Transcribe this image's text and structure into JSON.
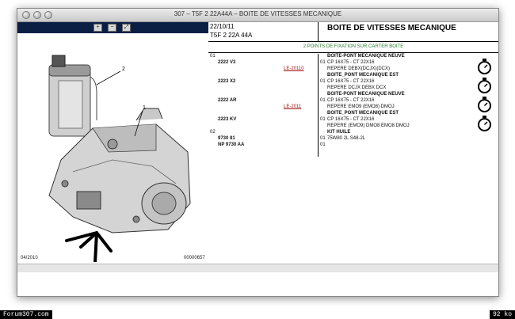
{
  "window": {
    "title": "307 – T5F 2 22A44A – BOITE DE VITESSES MECANIQUE"
  },
  "image_toolbar": {
    "zoom_in_icon": "magnifier-plus-icon",
    "zoom_out_icon": "magnifier-minus-icon",
    "fit_icon": "magnifier-fit-icon"
  },
  "figure": {
    "callout_1": "1",
    "callout_2": "2",
    "date": "04/2010",
    "ref": "00000657"
  },
  "header": {
    "date": "22/10/11",
    "code": "T5F 2 22A 44A",
    "description": "BOITE DE VITESSES MECANIQUE"
  },
  "fixing_note": "2 POINTS DE FIXATION SUR CARTER BOITE",
  "parts": [
    {
      "col1": "01",
      "col2": "",
      "qty": "",
      "text": "BOITE-PONT MECANIQUE NEUVE",
      "bold": true
    },
    {
      "col1": "",
      "col2": "2222 V3",
      "qty": "01",
      "text": "CP 16X75 - CT 22X16",
      "bold": false
    },
    {
      "col1": "",
      "col2": "LE-20110",
      "qty": "",
      "text": "REPERE DEBX(DCJX)(DCX)",
      "bold": false,
      "red": true
    },
    {
      "col1": "",
      "col2": "",
      "qty": "",
      "text": "BOITE_PONT MECANIQUE EST",
      "bold": true
    },
    {
      "col1": "",
      "col2": "2223 X2",
      "qty": "01",
      "text": "CP 16X75 - CT 22X16",
      "bold": false
    },
    {
      "col1": "",
      "col2": "",
      "qty": "",
      "text": "REPERE DCJX DEBX DCX",
      "bold": false
    },
    {
      "col1": "",
      "col2": "",
      "qty": "",
      "text": "BOITE-PONT MECANIQUE NEUVE",
      "bold": true
    },
    {
      "col1": "",
      "col2": "2222 AR",
      "qty": "01",
      "text": "CP 16X75 - CT 22X16",
      "bold": false
    },
    {
      "col1": "",
      "col2": "LE-2011",
      "qty": "",
      "text": "REPERE EMO9 (EMO8) DMOJ",
      "bold": false,
      "red": true
    },
    {
      "col1": "",
      "col2": "",
      "qty": "",
      "text": "BOITE_PONT MECANIQUE EST",
      "bold": true
    },
    {
      "col1": "",
      "col2": "2223 KV",
      "qty": "01",
      "text": "CP 16X75 - CT 22X16",
      "bold": false
    },
    {
      "col1": "",
      "col2": "",
      "qty": "",
      "text": "REPERE (EMO9) DMO8 EMO8 DMOJ",
      "bold": false
    },
    {
      "col1": "02",
      "col2": "",
      "qty": "",
      "text": "KIT HUILE",
      "bold": true
    },
    {
      "col1": "",
      "col2": "9730 81",
      "qty": "01",
      "text": "75W80 2L S48-2L",
      "bold": false
    },
    {
      "col1": "",
      "col2": "NP 9730 AA",
      "qty": "01",
      "text": "",
      "bold": true
    }
  ],
  "badges": {
    "left": "Forum307.com",
    "right": "92 ko"
  }
}
